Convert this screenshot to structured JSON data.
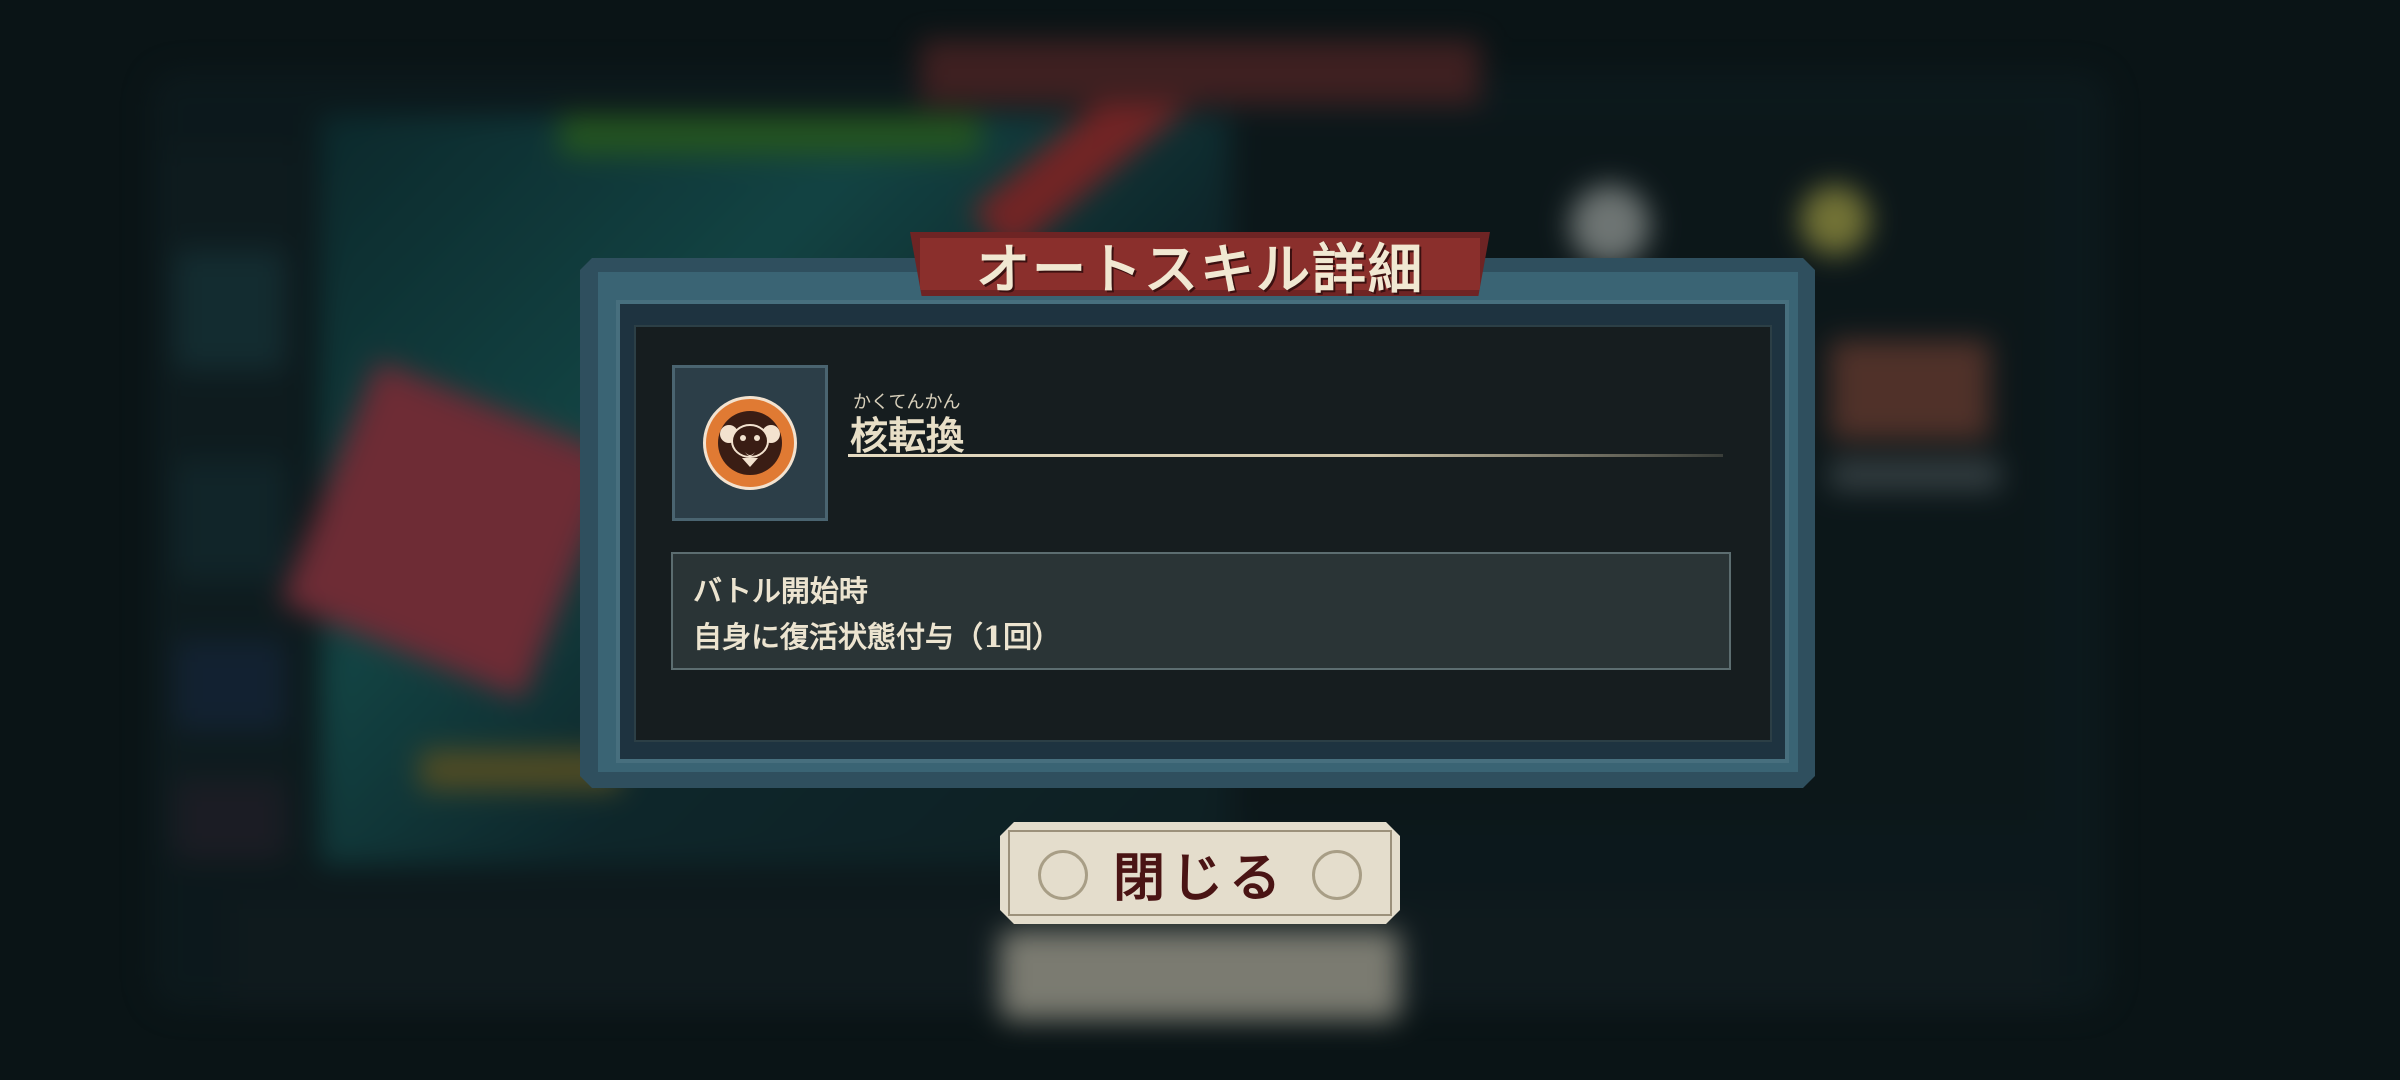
{
  "dialog": {
    "title": "オートスキル詳細",
    "skill": {
      "icon": "nuclear-mask-icon",
      "furigana": "かくてんかん",
      "name": "核転換"
    },
    "description": {
      "trigger": "バトル開始時",
      "effect": "自身に復活状態付与（1回）"
    },
    "close_label": "閉じる"
  },
  "colors": {
    "banner": "#8a2f2c",
    "icon_bg": "#e07a33",
    "frame": "#476f7e"
  }
}
